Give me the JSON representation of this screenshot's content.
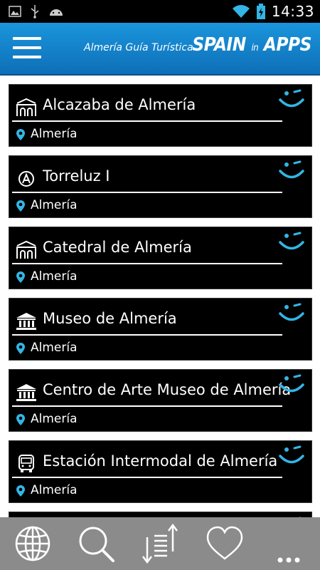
{
  "status_bar": {
    "time": "14:33",
    "icons": [
      "image-icon",
      "usb-icon",
      "android-icon",
      "wifi-icon",
      "battery-charging-icon"
    ]
  },
  "header": {
    "title": "Almería Guía Turística",
    "brand_main_1": "SPAIN",
    "brand_small": "in",
    "brand_main_2": "APPS",
    "accent": "#1a95dc"
  },
  "places": [
    {
      "name": "Alcazaba de Almería",
      "location": "Almería",
      "icon": "arch-monument-icon"
    },
    {
      "name": "Torreluz I",
      "location": "Almería",
      "icon": "hotel-category-icon"
    },
    {
      "name": "Catedral de Almería",
      "location": "Almería",
      "icon": "arch-monument-icon"
    },
    {
      "name": "Museo de Almería",
      "location": "Almería",
      "icon": "museum-icon"
    },
    {
      "name": "Centro de Arte Museo de Almería",
      "location": "Almería",
      "icon": "museum-icon"
    },
    {
      "name": "Estación Intermodal de Almería",
      "location": "Almería",
      "icon": "bus-icon"
    }
  ],
  "bottom_bar": [
    "globe-icon",
    "search-icon",
    "sort-icon",
    "heart-icon",
    "more-icon"
  ]
}
